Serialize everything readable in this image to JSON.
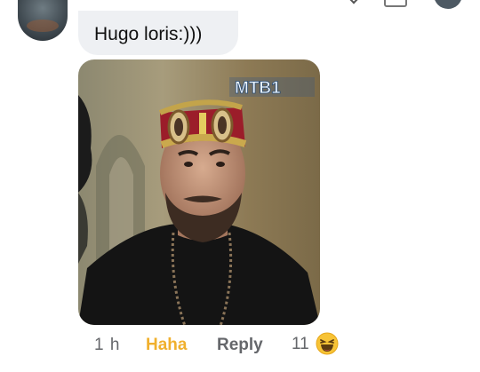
{
  "comment": {
    "text": "Hugo loris:)))",
    "time": "1 h",
    "reaction_label": "Haha",
    "reply_label": "Reply",
    "reaction_count": "11",
    "reaction_icon": "haha-emoji-icon"
  },
  "photo": {
    "watermark": "MTB1"
  },
  "colors": {
    "bubble": "#eef0f3",
    "haha": "#f0b02e",
    "meta": "#65676b"
  }
}
